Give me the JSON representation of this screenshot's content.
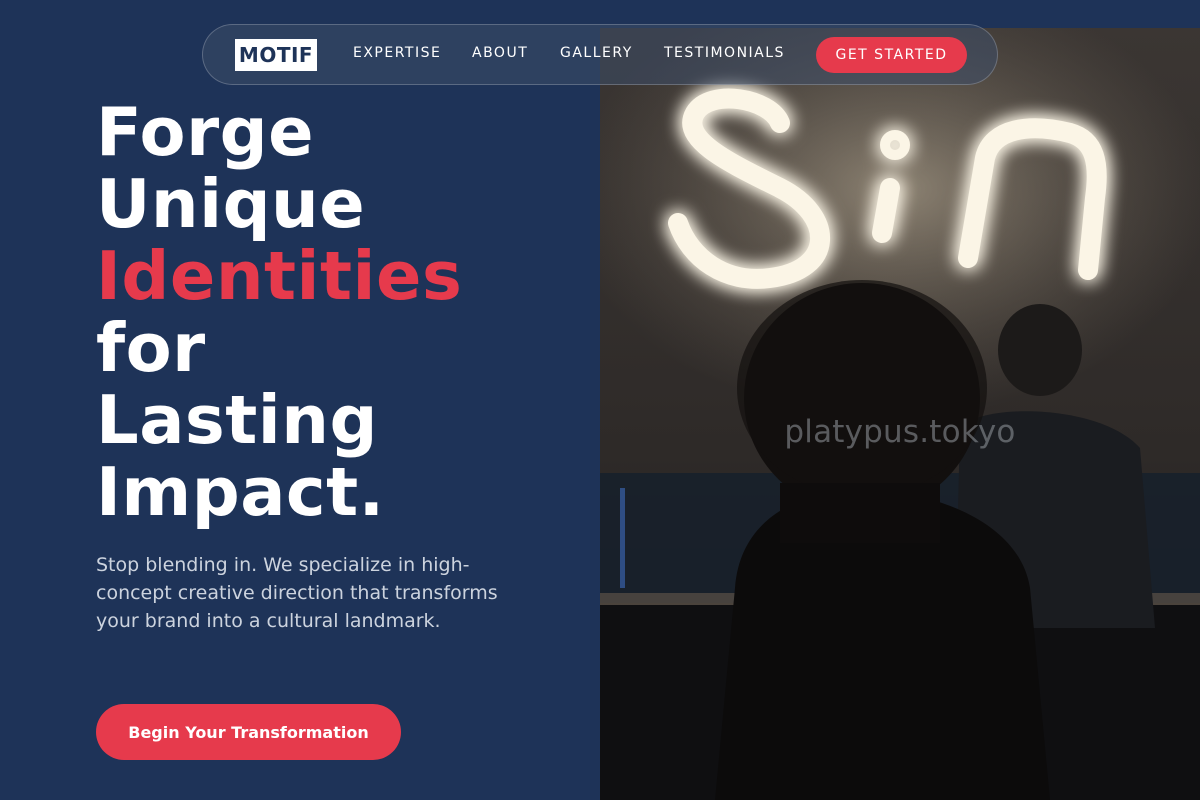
{
  "nav": {
    "logo": "MOTIF",
    "links": [
      "EXPERTISE",
      "ABOUT",
      "GALLERY",
      "TESTIMONIALS"
    ],
    "cta_label": "GET STARTED"
  },
  "hero": {
    "headline_lines": [
      "Forge",
      "Unique",
      "Identities",
      "for",
      "Lasting",
      "Impact."
    ],
    "accent_line_index": 2,
    "subtext": "Stop blending in. We specialize in high-concept creative direction that transforms your brand into a cultural landmark.",
    "cta_label": "Begin Your Transformation"
  },
  "image": {
    "description_icon": "neon-sign-photo",
    "watermark": "platypus.tokyo"
  },
  "colors": {
    "background": "#1e3358",
    "accent": "#e63a4c",
    "text": "#ffffff",
    "muted_text": "#ccd3de"
  }
}
